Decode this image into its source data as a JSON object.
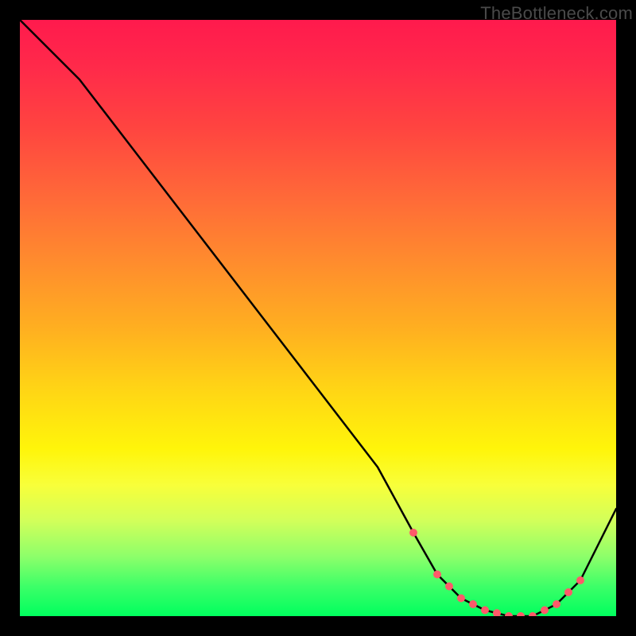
{
  "watermark": "TheBottleneck.com",
  "chart_data": {
    "type": "line",
    "title": "",
    "xlabel": "",
    "ylabel": "",
    "xlim": [
      0,
      100
    ],
    "ylim": [
      0,
      100
    ],
    "background_gradient": {
      "orientation": "vertical",
      "stops": [
        {
          "pos": 0.0,
          "color": "#ff1a4d"
        },
        {
          "pos": 0.3,
          "color": "#ff6a38"
        },
        {
          "pos": 0.6,
          "color": "#ffd515"
        },
        {
          "pos": 0.8,
          "color": "#e0ff40"
        },
        {
          "pos": 1.0,
          "color": "#00ff5e"
        }
      ]
    },
    "series": [
      {
        "name": "curve",
        "color": "#000000",
        "x": [
          0,
          5,
          10,
          20,
          30,
          40,
          50,
          60,
          66,
          70,
          74,
          78,
          82,
          86,
          90,
          94,
          100
        ],
        "y": [
          100,
          95,
          90,
          77,
          64,
          51,
          38,
          25,
          14,
          7,
          3,
          1,
          0,
          0,
          2,
          6,
          18
        ]
      }
    ],
    "markers": {
      "name": "dots",
      "color": "#ff5a6a",
      "radius": 5,
      "x": [
        66,
        70,
        72,
        74,
        76,
        78,
        80,
        82,
        84,
        86,
        88,
        90,
        92,
        94
      ],
      "y": [
        14,
        7,
        5,
        3,
        2,
        1,
        0.5,
        0,
        0,
        0,
        1,
        2,
        4,
        6
      ]
    }
  }
}
